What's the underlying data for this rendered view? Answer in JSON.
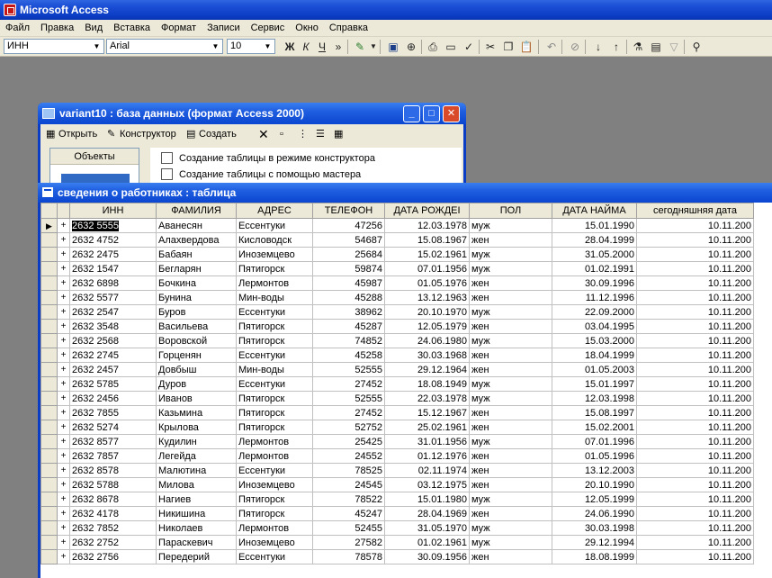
{
  "app": {
    "title": "Microsoft Access"
  },
  "menu": [
    "Файл",
    "Правка",
    "Вид",
    "Вставка",
    "Формат",
    "Записи",
    "Сервис",
    "Окно",
    "Справка"
  ],
  "toolbar": {
    "field_value": "ИНН",
    "font_value": "Arial",
    "size_value": "10",
    "bold": "Ж",
    "italic": "К",
    "underline": "Ч"
  },
  "db_window": {
    "title": "variant10 : база данных (формат Access 2000)",
    "open_label": "Открыть",
    "design_label": "Конструктор",
    "create_label": "Создать",
    "objects_header": "Объекты",
    "list_items": [
      "Создание таблицы в режиме конструктора",
      "Создание таблицы с помощью мастера"
    ]
  },
  "table_window": {
    "title": "сведения о работниках : таблица",
    "columns": [
      "ИНН",
      "ФАМИЛИЯ",
      "АДРЕС",
      "ТЕЛЕФОН",
      "ДАТА РОЖДЕІ",
      "ПОЛ",
      "ДАТА НАЙМА",
      "сегодняшняя дата"
    ],
    "rows": [
      [
        "2632 5555",
        "Аванесян",
        "Ессентуки",
        "47256",
        "12.03.1978",
        "муж",
        "15.01.1990",
        "10.11.200"
      ],
      [
        "2632 4752",
        "Алахвердова",
        "Кисловодск",
        "54687",
        "15.08.1967",
        "жен",
        "28.04.1999",
        "10.11.200"
      ],
      [
        "2632 2475",
        "Бабаян",
        "Иноземцево",
        "25684",
        "15.02.1961",
        "муж",
        "31.05.2000",
        "10.11.200"
      ],
      [
        "2632 1547",
        "Бегларян",
        "Пятигорск",
        "59874",
        "07.01.1956",
        "муж",
        "01.02.1991",
        "10.11.200"
      ],
      [
        "2632 6898",
        "Бочкина",
        "Лермонтов",
        "45987",
        "01.05.1976",
        "жен",
        "30.09.1996",
        "10.11.200"
      ],
      [
        "2632 5577",
        "Бунина",
        "Мин-воды",
        "45288",
        "13.12.1963",
        "жен",
        "11.12.1996",
        "10.11.200"
      ],
      [
        "2632 2547",
        "Буров",
        "Ессентуки",
        "38962",
        "20.10.1970",
        "муж",
        "22.09.2000",
        "10.11.200"
      ],
      [
        "2632 3548",
        "Васильева",
        "Пятигорск",
        "45287",
        "12.05.1979",
        "жен",
        "03.04.1995",
        "10.11.200"
      ],
      [
        "2632 2568",
        "Воровской",
        "Пятигорск",
        "74852",
        "24.06.1980",
        "муж",
        "15.03.2000",
        "10.11.200"
      ],
      [
        "2632 2745",
        "Горценян",
        "Ессентуки",
        "45258",
        "30.03.1968",
        "жен",
        "18.04.1999",
        "10.11.200"
      ],
      [
        "2632 2457",
        "Довбыш",
        "Мин-воды",
        "52555",
        "29.12.1964",
        "жен",
        "01.05.2003",
        "10.11.200"
      ],
      [
        "2632 5785",
        "Дуров",
        "Ессентуки",
        "27452",
        "18.08.1949",
        "муж",
        "15.01.1997",
        "10.11.200"
      ],
      [
        "2632 2456",
        "Иванов",
        "Пятигорск",
        "52555",
        "22.03.1978",
        "муж",
        "12.03.1998",
        "10.11.200"
      ],
      [
        "2632 7855",
        "Казьмина",
        "Пятигорск",
        "27452",
        "15.12.1967",
        "жен",
        "15.08.1997",
        "10.11.200"
      ],
      [
        "2632 5274",
        "Крылова",
        "Пятигорск",
        "52752",
        "25.02.1961",
        "жен",
        "15.02.2001",
        "10.11.200"
      ],
      [
        "2632 8577",
        "Кудилин",
        "Лермонтов",
        "25425",
        "31.01.1956",
        "муж",
        "07.01.1996",
        "10.11.200"
      ],
      [
        "2632 7857",
        "Легейда",
        "Лермонтов",
        "24552",
        "01.12.1976",
        "жен",
        "01.05.1996",
        "10.11.200"
      ],
      [
        "2632 8578",
        "Малютина",
        "Ессентуки",
        "78525",
        "02.11.1974",
        "жен",
        "13.12.2003",
        "10.11.200"
      ],
      [
        "2632 5788",
        "Милова",
        "Иноземцево",
        "24545",
        "03.12.1975",
        "жен",
        "20.10.1990",
        "10.11.200"
      ],
      [
        "2632 8678",
        "Нагиев",
        "Пятигорск",
        "78522",
        "15.01.1980",
        "муж",
        "12.05.1999",
        "10.11.200"
      ],
      [
        "2632 4178",
        "Никишина",
        "Пятигорск",
        "45247",
        "28.04.1969",
        "жен",
        "24.06.1990",
        "10.11.200"
      ],
      [
        "2632 7852",
        "Николаев",
        "Лермонтов",
        "52455",
        "31.05.1970",
        "муж",
        "30.03.1998",
        "10.11.200"
      ],
      [
        "2632 2752",
        "Параскевич",
        "Иноземцево",
        "27582",
        "01.02.1961",
        "муж",
        "29.12.1994",
        "10.11.200"
      ],
      [
        "2632 2756",
        "Передерий",
        "Ессентуки",
        "78578",
        "30.09.1956",
        "жен",
        "18.08.1999",
        "10.11.200"
      ]
    ]
  }
}
